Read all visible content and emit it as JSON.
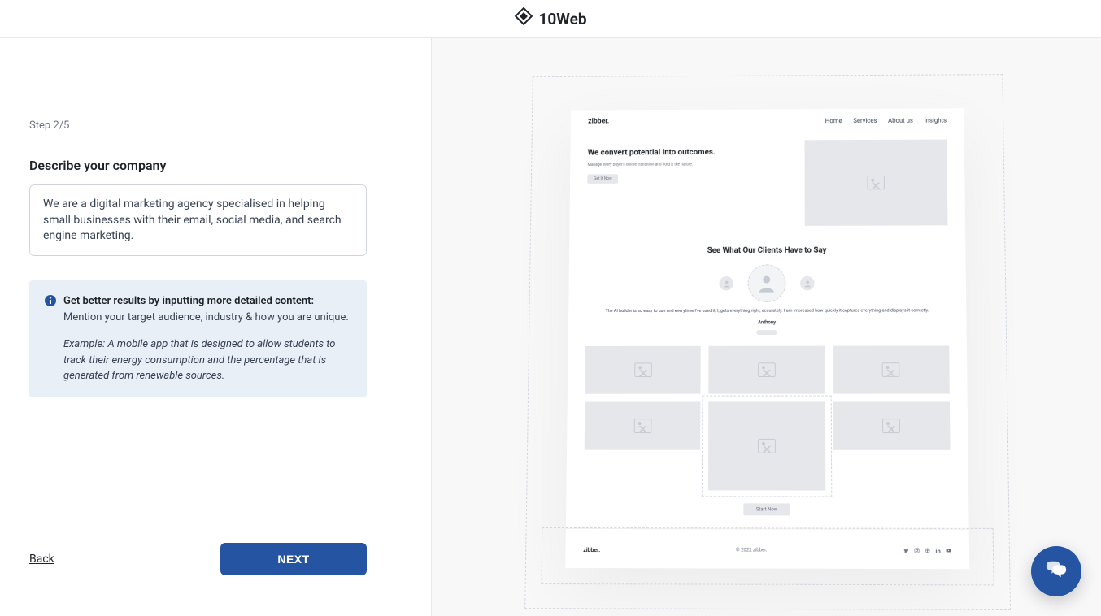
{
  "brand": "10Web",
  "step": {
    "label": "Step 2/5"
  },
  "form": {
    "label": "Describe your company",
    "value": "We are a digital marketing agency specialised in helping small businesses with their email, social media, and search engine marketing."
  },
  "tip": {
    "title": "Get better results by inputting more detailed content:",
    "sub": "Mention your target audience, industry & how you are unique.",
    "example": "Example: A mobile app that is designed to allow students to track their energy consumption and the percentage that is generated from renewable sources."
  },
  "actions": {
    "back": "Back",
    "next": "NEXT"
  },
  "preview": {
    "brand": "zibber.",
    "nav": [
      "Home",
      "Services",
      "About us",
      "Insights"
    ],
    "hero_title": "We convert potential into outcomes.",
    "hero_sub": "Manage every buyer's online transition and hold it the nature.",
    "hero_cta": "Get It Now",
    "clients_title": "See What Our Clients Have to Say",
    "testimonial": "The AI builder is so easy to use and everytime I've used it, I, gets everything right, accurately. I am impressed how quickly it captures everything and displays it correctly.",
    "author": "Anthony",
    "start_cta": "Start Now",
    "copyright": "© 2022 zibber."
  }
}
